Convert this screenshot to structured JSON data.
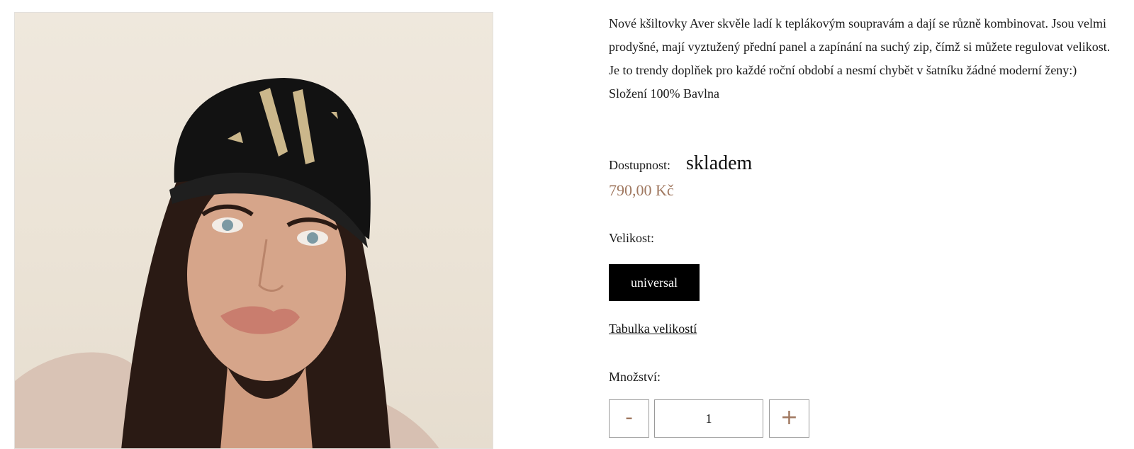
{
  "product": {
    "description_lines": [
      "Nové kšiltovky Aver skvěle ladí k teplákovým soupravám a dají se různě kombinovat. Jsou velmi prodyšné, mají vyztužený přední panel a zapínání na suchý zip, čímž si můžete regulovat velikost. Je to trendy doplňek pro každé roční období a nesmí chybět v šatníku žádné moderní ženy:)",
      "Složení 100% Bavlna"
    ],
    "availability_label": "Dostupnost:",
    "availability_value": "skladem",
    "price": "790,00 Kč",
    "size_label": "Velikost:",
    "size_option": "universal",
    "size_table_link": "Tabulka velikostí",
    "quantity_label": "Množství:",
    "quantity_value": "1",
    "minus_label": "-",
    "plus_label": "+"
  },
  "colors": {
    "price": "#a07860",
    "size_button_bg": "#000000"
  }
}
